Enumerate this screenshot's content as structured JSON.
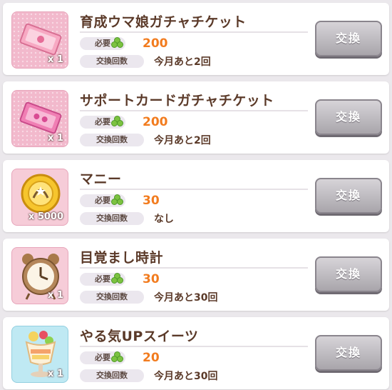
{
  "labels": {
    "cost": "必要",
    "count": "交換回数",
    "exchange": "交換"
  },
  "items": [
    {
      "name": "育成ウマ娘ガチャチケット",
      "qty": "x 1",
      "cost": "200",
      "limit": "今月あと2回",
      "icon": "ticket-pink-icon"
    },
    {
      "name": "サポートカードガチャチケット",
      "qty": "x 1",
      "cost": "200",
      "limit": "今月あと2回",
      "icon": "ticket-magenta-icon"
    },
    {
      "name": "マニー",
      "qty": "x 5000",
      "cost": "30",
      "limit": "なし",
      "icon": "coin-icon"
    },
    {
      "name": "目覚まし時計",
      "qty": "x 1",
      "cost": "30",
      "limit": "今月あと30回",
      "icon": "alarm-clock-icon"
    },
    {
      "name": "やる気UPスイーツ",
      "qty": "x 1",
      "cost": "20",
      "limit": "今月あと30回",
      "icon": "parfait-icon"
    }
  ]
}
